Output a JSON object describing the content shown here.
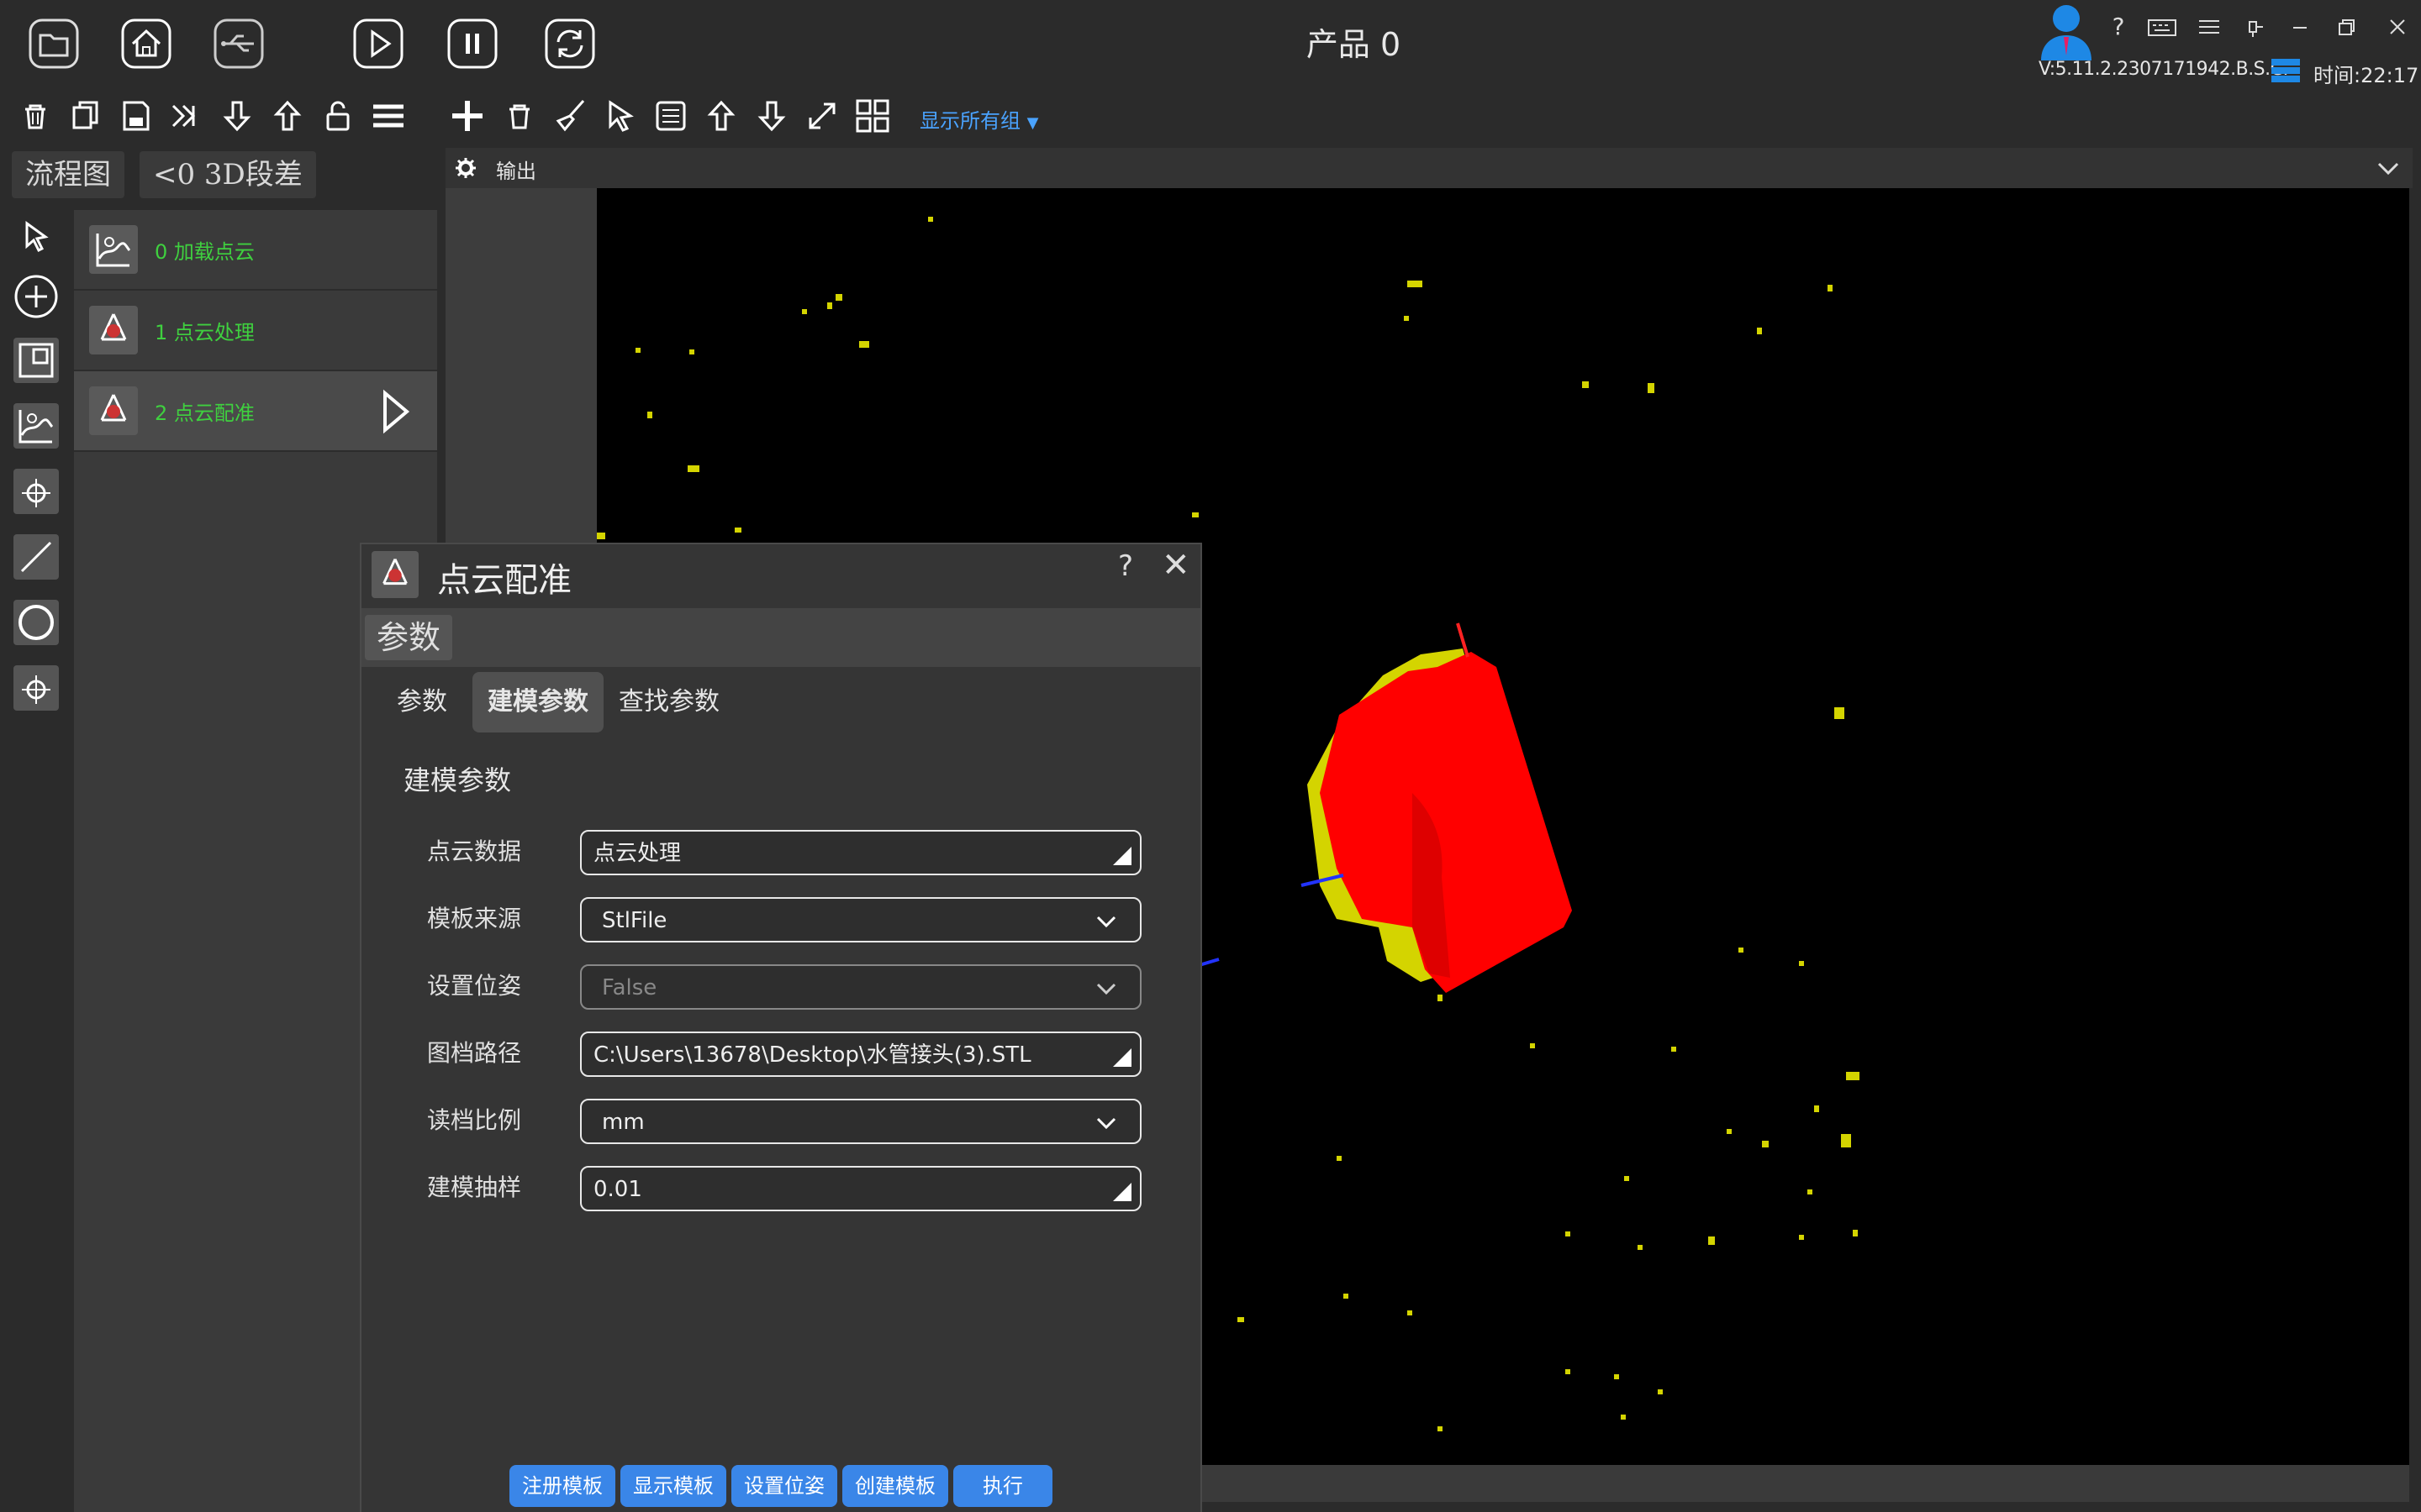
{
  "header": {
    "product_label": "产品  0",
    "version": "V:5.11.2.2307171942.B.S.C.",
    "time": "时间:22:17",
    "help_icon": "?",
    "group_dropdown": "显示所有组"
  },
  "tabs": [
    {
      "label": "流程图"
    },
    {
      "label": "<0  3D段差"
    }
  ],
  "flow": {
    "items": [
      {
        "label": "0  加载点云"
      },
      {
        "label": "1  点云处理"
      },
      {
        "label": "2  点云配准"
      }
    ]
  },
  "output": {
    "label": "输出"
  },
  "dialog": {
    "title": "点云配准",
    "help": "?",
    "close": "✕",
    "section": "参数",
    "tabs": [
      "参数",
      "建模参数",
      "查找参数"
    ],
    "group_title": "建模参数",
    "params": [
      {
        "label": "点云数据",
        "value": "点云处理"
      },
      {
        "label": "模板来源",
        "value": "StlFile"
      },
      {
        "label": "设置位姿",
        "value": "False"
      },
      {
        "label": "图档路径",
        "value": "C:\\Users\\13678\\Desktop\\水管接头(3).STL"
      },
      {
        "label": "读档比例",
        "value": "mm"
      },
      {
        "label": "建模抽样",
        "value": "0.01"
      }
    ],
    "buttons": [
      "注册模板",
      "显示模板",
      "设置位姿",
      "创建模板",
      "执行"
    ]
  },
  "colors": {
    "model": "#ff0000",
    "points": "#d4d400",
    "accent": "#3a86e8",
    "flow_text": "#3fd03f"
  }
}
